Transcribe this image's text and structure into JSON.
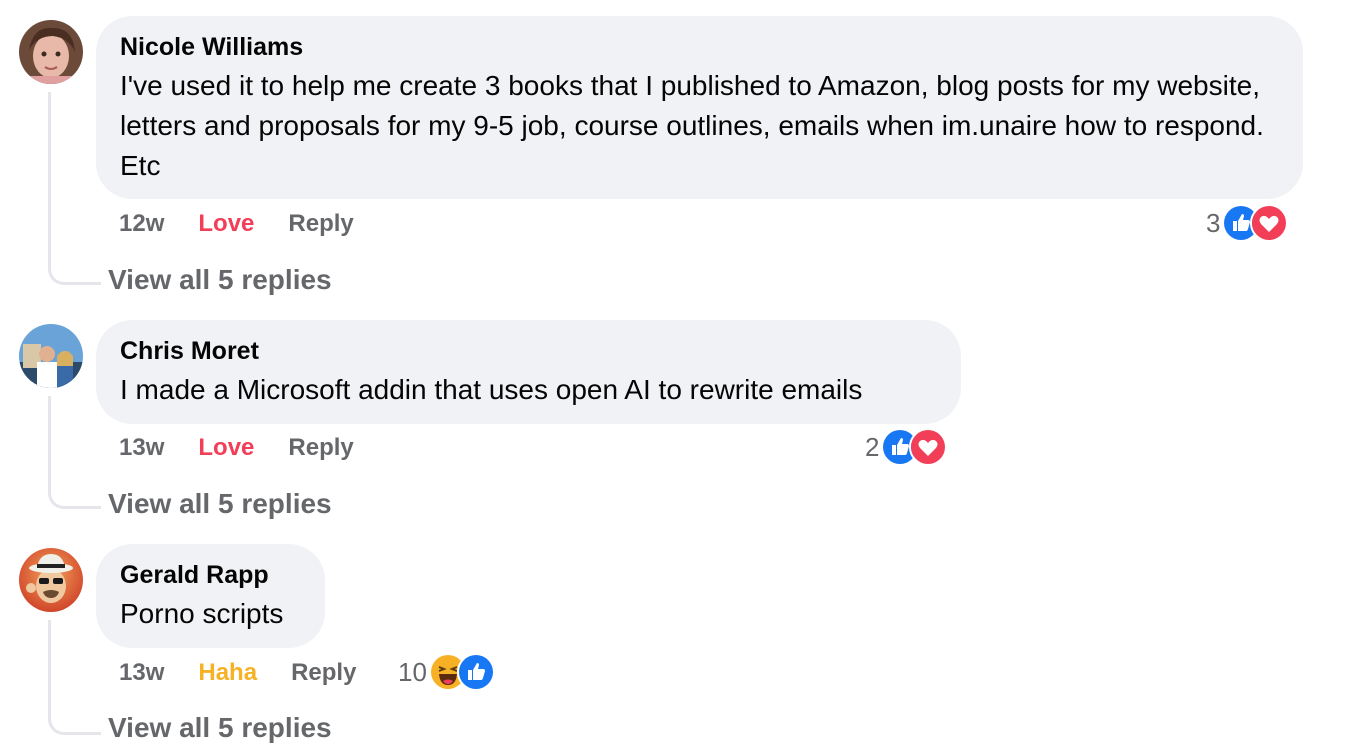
{
  "comments": [
    {
      "author": "Nicole Williams",
      "text": "I've used it to help me create 3 books that I published to Amazon, blog posts for my website, letters and proposals for my 9-5 job, course outlines, emails when im.unaire how to respond. Etc",
      "time": "12w",
      "reaction_label": "Love",
      "reply_label": "Reply",
      "reaction_count": "3",
      "reaction_icons": [
        "like-icon",
        "love-icon"
      ],
      "view_replies": "View all 5 replies"
    },
    {
      "author": "Chris Moret",
      "text": "I made a Microsoft addin that uses open AI to rewrite emails",
      "time": "13w",
      "reaction_label": "Love",
      "reply_label": "Reply",
      "reaction_count": "2",
      "reaction_icons": [
        "like-icon",
        "love-icon"
      ],
      "view_replies": "View all 5 replies"
    },
    {
      "author": "Gerald Rapp",
      "text": "Porno scripts",
      "time": "13w",
      "reaction_label": "Haha",
      "reply_label": "Reply",
      "reaction_count": "10",
      "reaction_icons": [
        "haha-icon",
        "like-icon"
      ],
      "view_replies": "View all 5 replies"
    }
  ],
  "colors": {
    "bubble": "#f0f2f5",
    "secondary_text": "#65676b",
    "love": "#f33e58",
    "haha": "#f7b125",
    "like": "#1877f2"
  }
}
